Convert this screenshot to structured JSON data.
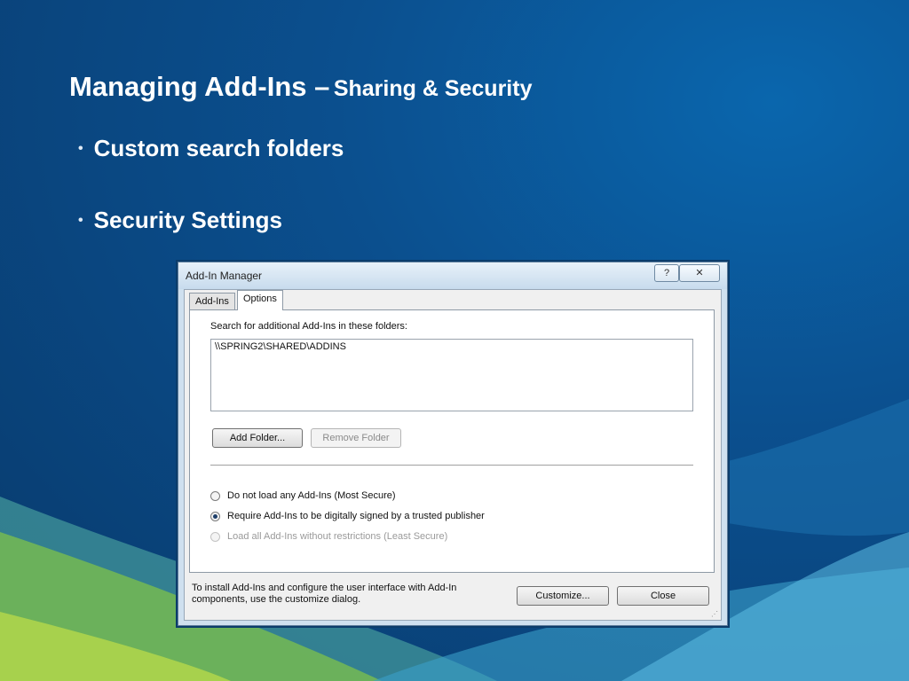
{
  "slide": {
    "title_main": "Managing Add-Ins –",
    "title_sub": "Sharing & Security",
    "bullets": [
      "Custom search folders",
      "Security Settings"
    ],
    "bullet_glyph": "•"
  },
  "dialog": {
    "title": "Add-In Manager",
    "help_glyph": "?",
    "close_glyph": "✕",
    "tabs": [
      {
        "label": "Add-Ins",
        "selected": false
      },
      {
        "label": "Options",
        "selected": true
      }
    ],
    "search_label": "Search for additional Add-Ins in these folders:",
    "folders": [
      "\\\\SPRING2\\SHARED\\ADDINS"
    ],
    "add_folder_label": "Add Folder...",
    "remove_folder_label": "Remove Folder",
    "security_options": [
      {
        "label": "Do not load any Add-Ins (Most Secure)",
        "selected": false,
        "enabled": true
      },
      {
        "label": "Require Add-Ins to be digitally signed by a trusted publisher",
        "selected": true,
        "enabled": true
      },
      {
        "label": "Load all Add-Ins without restrictions (Least Secure)",
        "selected": false,
        "enabled": false
      }
    ],
    "footer_text": "To install Add-Ins and configure the user interface with Add-In components, use the customize dialog.",
    "customize_label": "Customize...",
    "close_label": "Close"
  },
  "colors": {
    "background": "#0b4f8e",
    "title_text": "#ffffff",
    "dialog_frame": "#cfe0ef"
  }
}
